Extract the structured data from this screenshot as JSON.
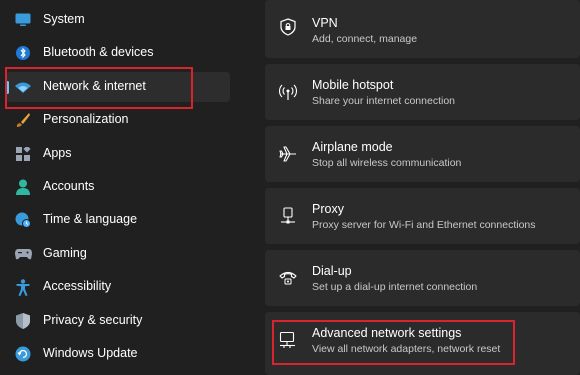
{
  "sidebar": {
    "items": [
      {
        "label": "System",
        "icon": "monitor-icon"
      },
      {
        "label": "Bluetooth & devices",
        "icon": "bluetooth-icon"
      },
      {
        "label": "Network & internet",
        "icon": "wifi-icon",
        "selected": true
      },
      {
        "label": "Personalization",
        "icon": "paintbrush-icon"
      },
      {
        "label": "Apps",
        "icon": "apps-icon"
      },
      {
        "label": "Accounts",
        "icon": "person-icon"
      },
      {
        "label": "Time & language",
        "icon": "globe-clock-icon"
      },
      {
        "label": "Gaming",
        "icon": "gamepad-icon"
      },
      {
        "label": "Accessibility",
        "icon": "accessibility-icon"
      },
      {
        "label": "Privacy & security",
        "icon": "shield-icon"
      },
      {
        "label": "Windows Update",
        "icon": "update-icon"
      }
    ]
  },
  "main": {
    "cards": [
      {
        "title": "VPN",
        "desc": "Add, connect, manage",
        "icon": "vpn-shield-icon"
      },
      {
        "title": "Mobile hotspot",
        "desc": "Share your internet connection",
        "icon": "hotspot-icon"
      },
      {
        "title": "Airplane mode",
        "desc": "Stop all wireless communication",
        "icon": "airplane-icon"
      },
      {
        "title": "Proxy",
        "desc": "Proxy server for Wi-Fi and Ethernet connections",
        "icon": "proxy-icon"
      },
      {
        "title": "Dial-up",
        "desc": "Set up a dial-up internet connection",
        "icon": "phone-icon"
      },
      {
        "title": "Advanced network settings",
        "desc": "View all network adapters, network reset",
        "icon": "network-monitor-icon"
      }
    ]
  },
  "colors": {
    "background": "#202020",
    "card": "#2b2b2b",
    "accent": "#60cdff",
    "annotation": "#d9232e"
  }
}
